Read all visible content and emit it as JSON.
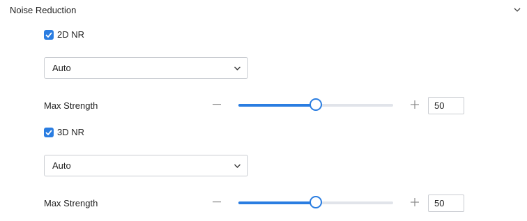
{
  "section": {
    "title": "Noise Reduction",
    "collapse_icon": "chevron-up-down-icon"
  },
  "nr2d": {
    "label": "2D NR",
    "checked": true,
    "mode": "Auto",
    "strength_label": "Max Strength",
    "strength_value": "50",
    "strength_fraction": 0.5
  },
  "nr3d": {
    "label": "3D NR",
    "checked": true,
    "mode": "Auto",
    "strength_label": "Max Strength",
    "strength_value": "50",
    "strength_fraction": 0.5
  },
  "colors": {
    "accent": "#2a7de1",
    "track": "#e1e4ea",
    "border": "#c9ccd1"
  }
}
